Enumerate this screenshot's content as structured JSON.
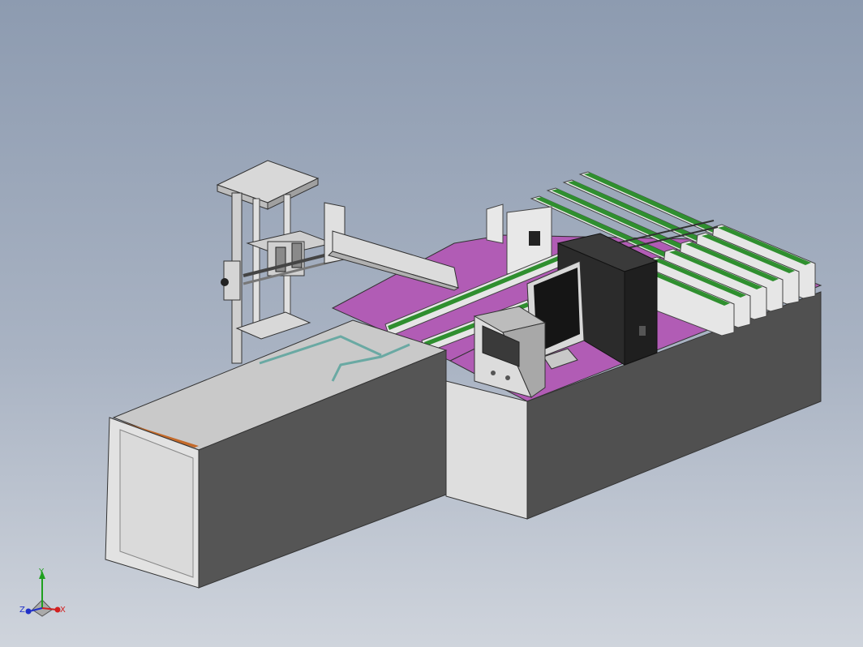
{
  "viewport": {
    "background_top": "#8d9bb0",
    "background_bottom": "#cfd4dc"
  },
  "model": {
    "base_top_color": "#b15cb5",
    "panel_light": "#d9d9d9",
    "panel_dark": "#4a4a4a",
    "rail_color": "#2f8f2f",
    "accent_edge": "#c46a2a"
  },
  "triad": {
    "y_label": "Y",
    "x_label": "X",
    "z_label": "Z",
    "x_color": "#d22020",
    "y_color": "#1fa01f",
    "z_color": "#2030c8"
  }
}
